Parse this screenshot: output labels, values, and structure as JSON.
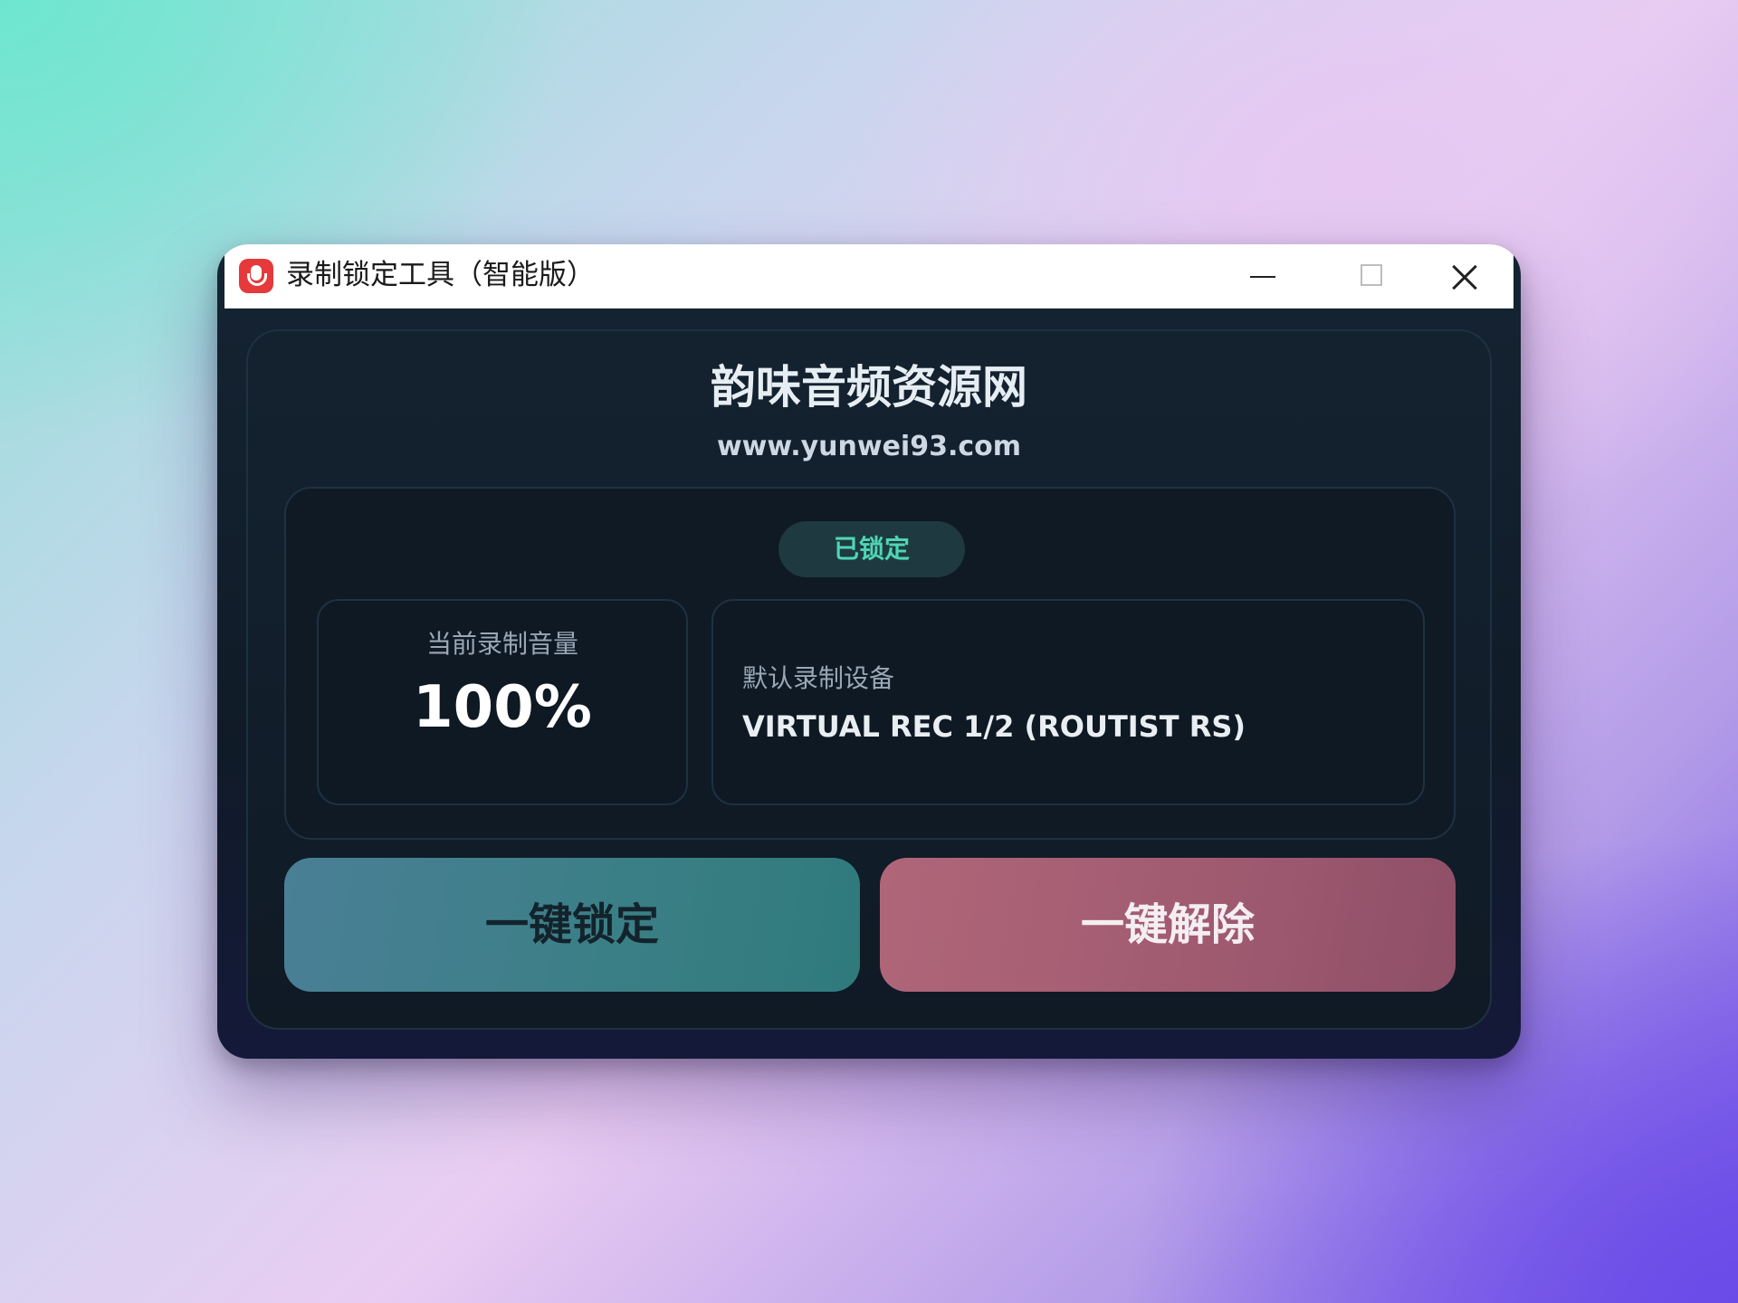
{
  "window": {
    "title": "录制锁定工具（智能版）",
    "app_icon": "microphone-icon",
    "controls": {
      "minimize_icon": "minimize-icon",
      "maximize_icon": "maximize-icon",
      "close_icon": "close-icon"
    }
  },
  "header": {
    "site_name": "韵味音频资源网",
    "site_url": "www.yunwei93.com"
  },
  "status": {
    "badge": "已锁定",
    "badge_color": "#4fd5b5",
    "volume_label": "当前录制音量",
    "volume_value": "100%",
    "device_label": "默认录制设备",
    "device_value": "VIRTUAL REC 1/2 (ROUTIST RS)"
  },
  "actions": {
    "lock_label": "一键锁定",
    "unlock_label": "一键解除",
    "lock_color": "#3a7f85",
    "unlock_color": "#9f5a70"
  }
}
